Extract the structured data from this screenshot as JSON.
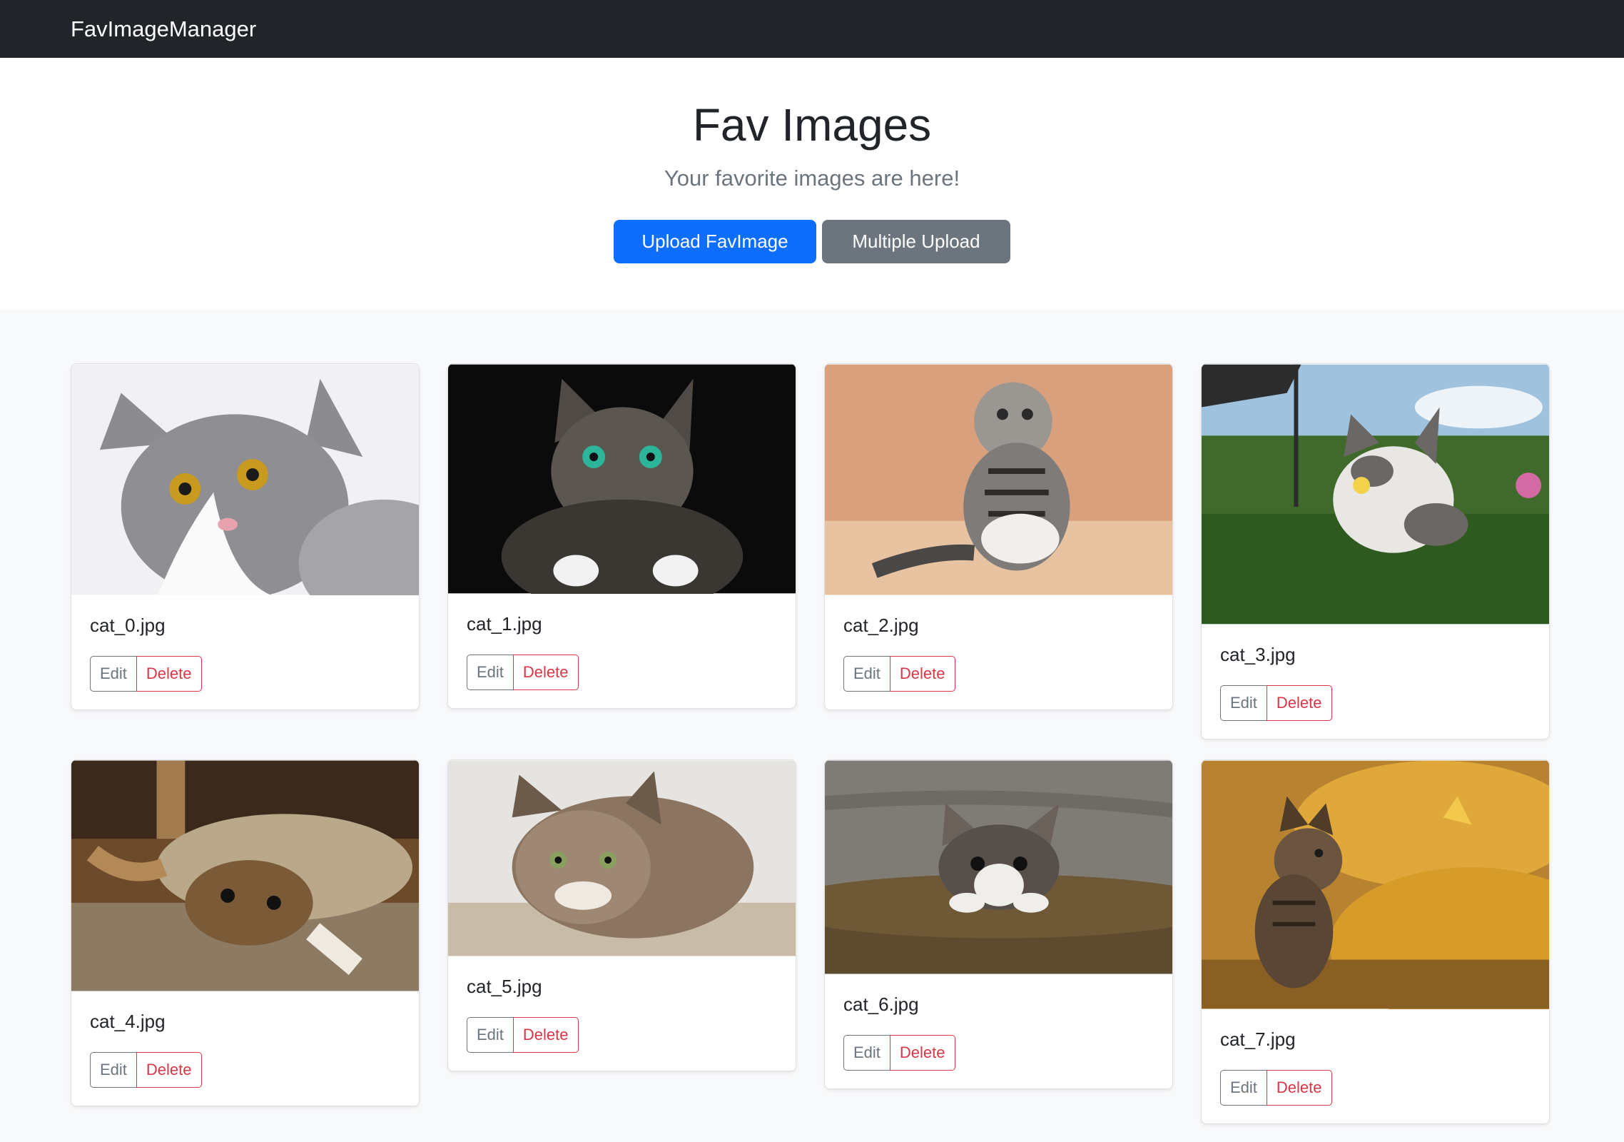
{
  "navbar": {
    "brand": "FavImageManager"
  },
  "hero": {
    "title": "Fav Images",
    "subtitle": "Your favorite images are here!",
    "upload_label": "Upload FavImage",
    "multi_upload_label": "Multiple Upload"
  },
  "cards": [
    {
      "title": "cat_0.jpg",
      "edit": "Edit",
      "delete": "Delete"
    },
    {
      "title": "cat_1.jpg",
      "edit": "Edit",
      "delete": "Delete"
    },
    {
      "title": "cat_2.jpg",
      "edit": "Edit",
      "delete": "Delete"
    },
    {
      "title": "cat_3.jpg",
      "edit": "Edit",
      "delete": "Delete"
    },
    {
      "title": "cat_4.jpg",
      "edit": "Edit",
      "delete": "Delete"
    },
    {
      "title": "cat_5.jpg",
      "edit": "Edit",
      "delete": "Delete"
    },
    {
      "title": "cat_6.jpg",
      "edit": "Edit",
      "delete": "Delete"
    },
    {
      "title": "cat_7.jpg",
      "edit": "Edit",
      "delete": "Delete"
    }
  ]
}
